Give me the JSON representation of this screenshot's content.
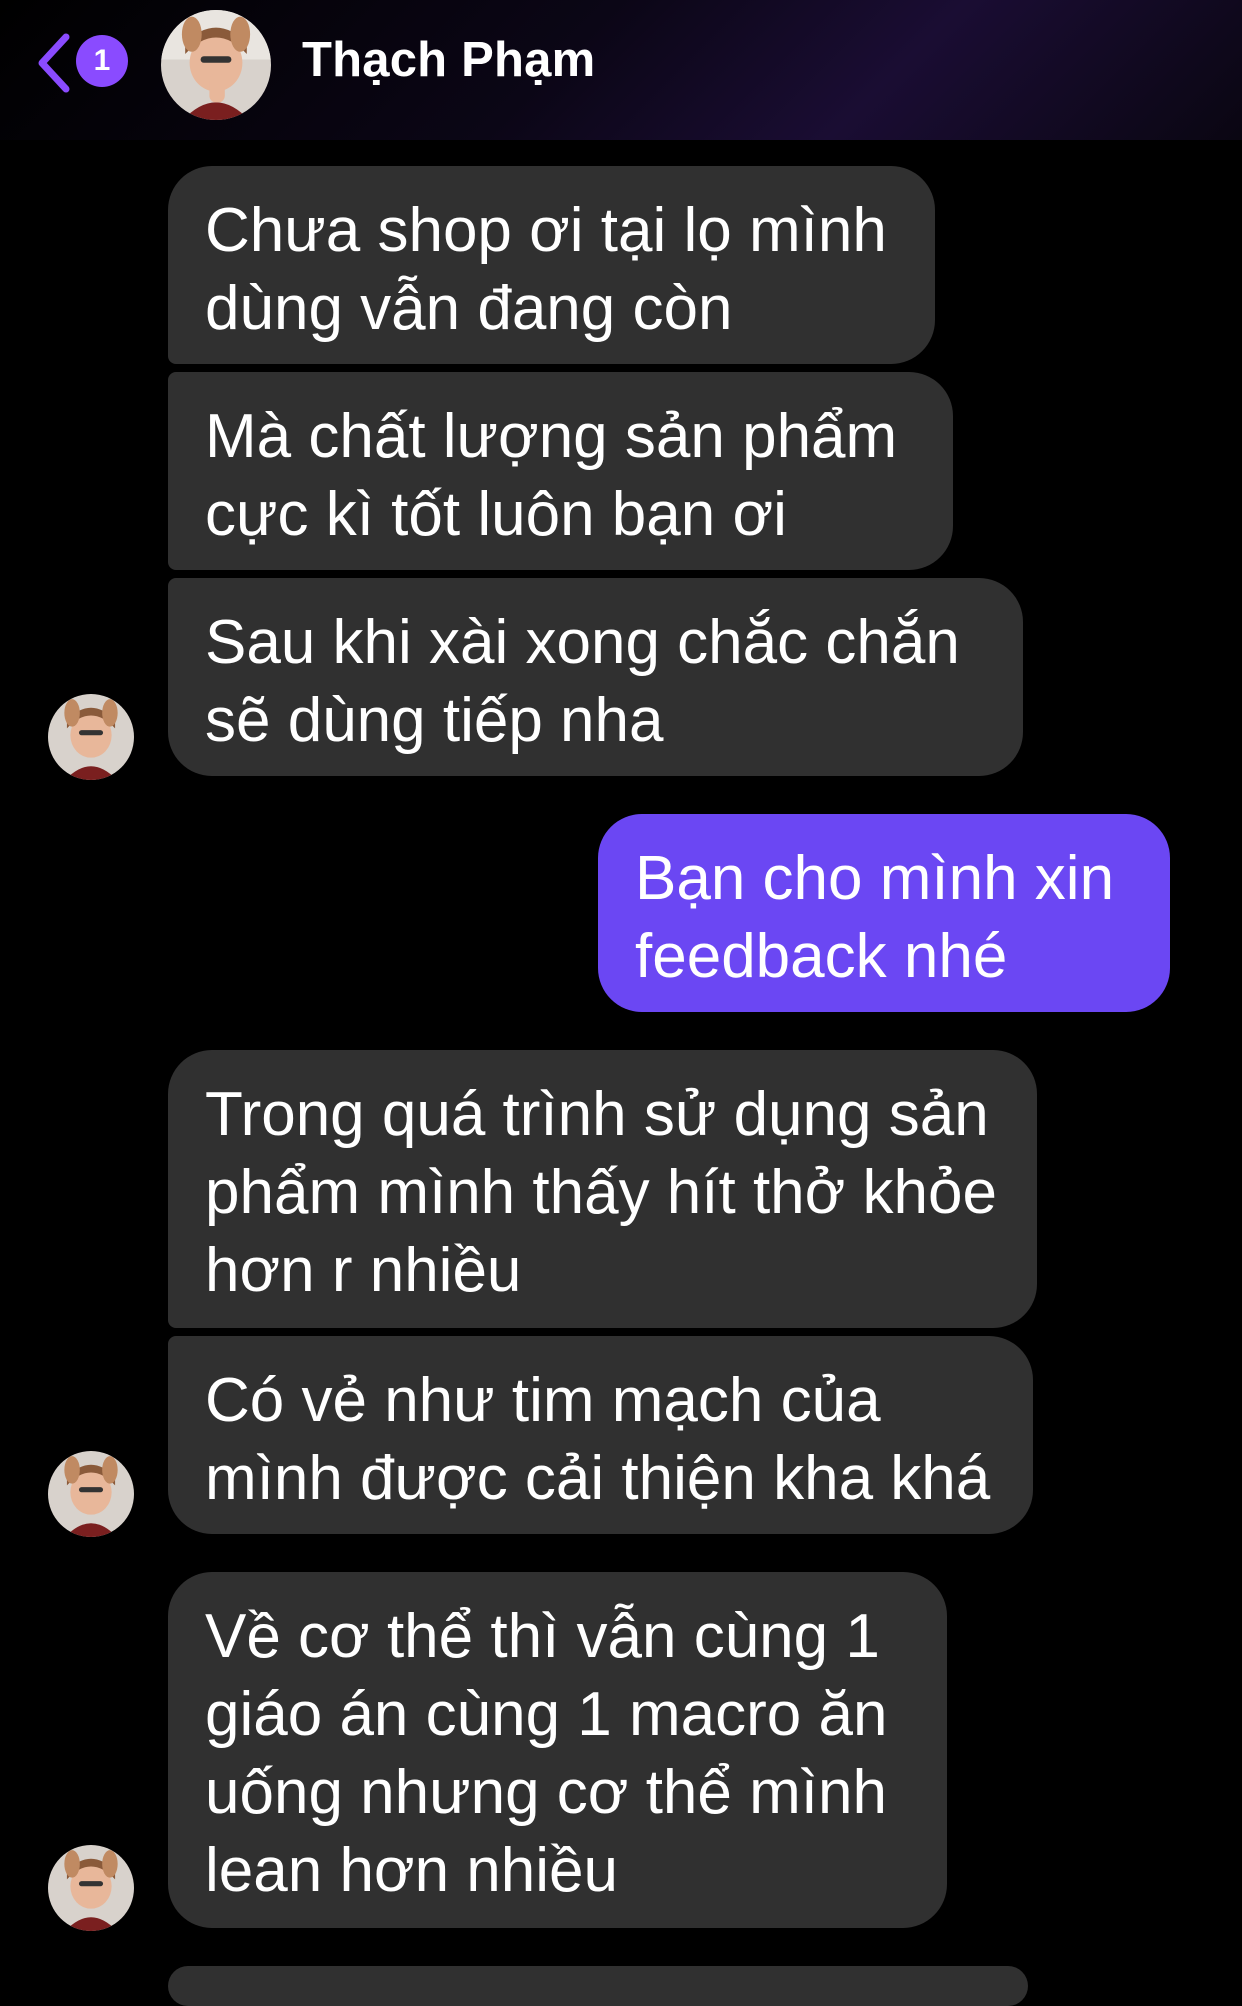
{
  "header": {
    "back_icon": "chevron-left-icon",
    "unread_count": "1",
    "contact_name": "Thạch Phạm",
    "accent_color": "#8a4bff"
  },
  "messages": [
    {
      "direction": "incoming",
      "text": "Chưa shop ơi tại lọ mình dùng vẫn đang còn"
    },
    {
      "direction": "incoming",
      "text": "Mà chất lượng sản phẩm cực kì tốt luôn bạn ơi"
    },
    {
      "direction": "incoming",
      "text": "Sau khi xài xong chắc chắn sẽ dùng tiếp nha"
    },
    {
      "direction": "outgoing",
      "text": "Bạn cho mình xin feedback nhé"
    },
    {
      "direction": "incoming",
      "text": "Trong quá trình sử dụng sản phẩm mình thấy hít thở khỏe hơn r nhiều"
    },
    {
      "direction": "incoming",
      "text": "Có vẻ như tim mạch của mình được cải thiện kha khá"
    },
    {
      "direction": "incoming",
      "text": "Về cơ thể thì vẫn cùng 1 giáo án cùng 1 macro ăn uống nhưng cơ thể mình lean hơn nhiều"
    }
  ],
  "colors": {
    "background": "#000000",
    "incoming_bubble": "#303030",
    "outgoing_bubble": "#6b47f3"
  }
}
